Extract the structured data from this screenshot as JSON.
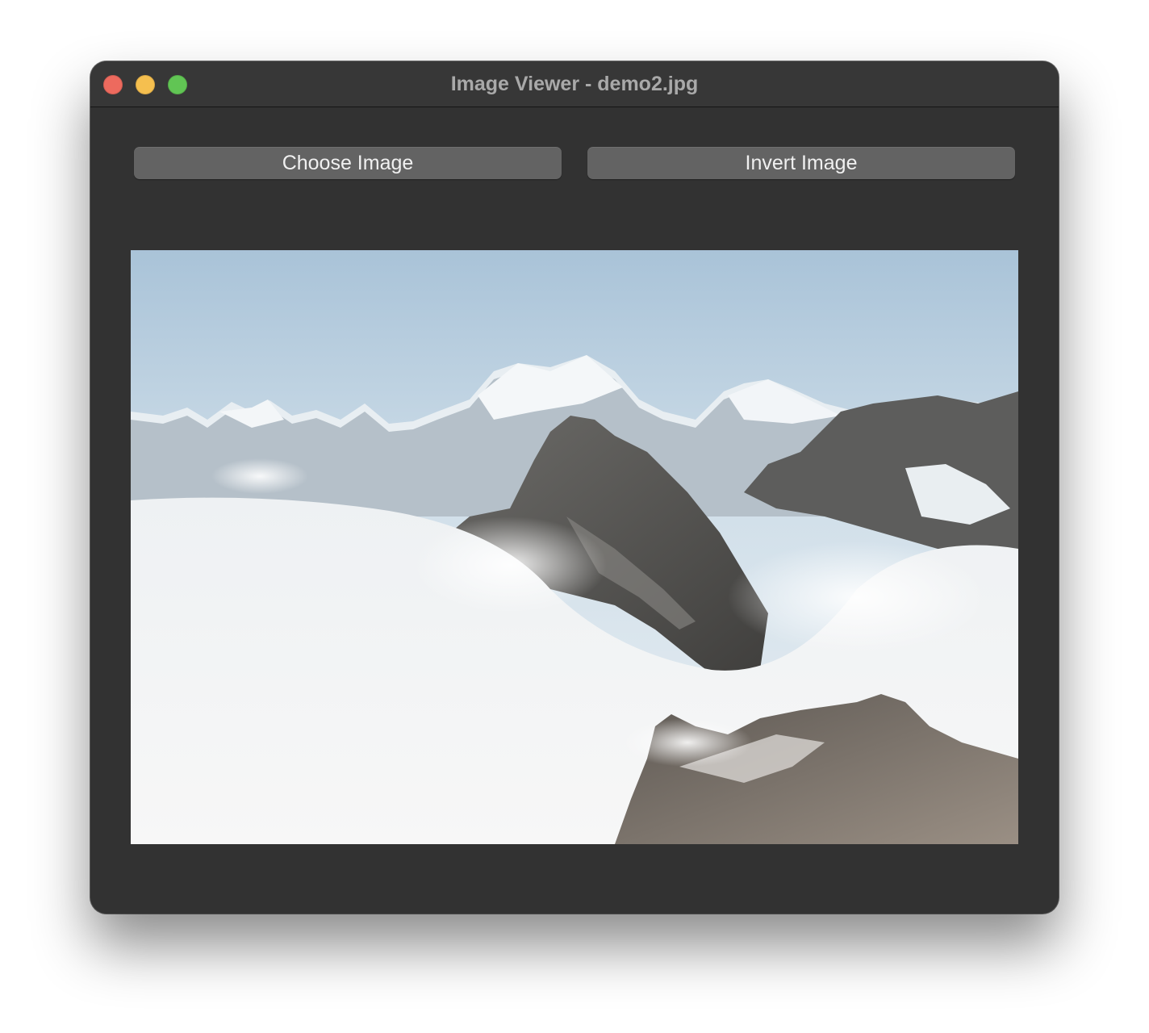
{
  "window": {
    "title": "Image Viewer - demo2.jpg",
    "controls": [
      "close",
      "minimize",
      "zoom"
    ]
  },
  "toolbar": {
    "choose_label": "Choose Image",
    "invert_label": "Invert Image"
  },
  "image": {
    "subject": "snowy mountain peaks above a sea of clouds"
  },
  "colors": {
    "window_bg": "#323232",
    "button_bg": "#636363",
    "close": "#ed6a5e",
    "minimize": "#f5bf4f",
    "zoom": "#61c554"
  }
}
